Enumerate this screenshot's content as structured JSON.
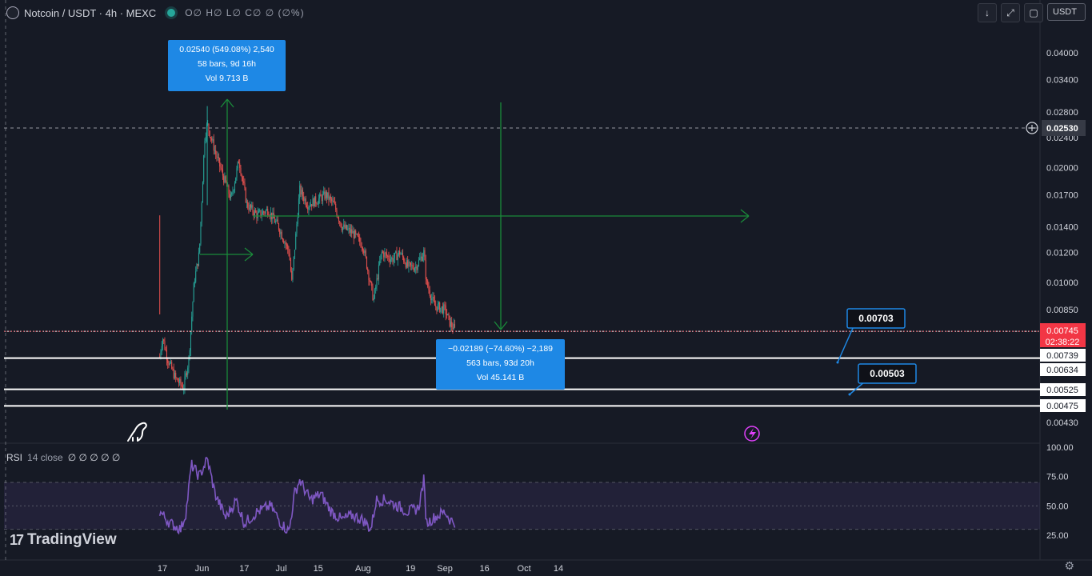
{
  "header": {
    "title": "Notcoin / USDT · 4h · MEXC",
    "ohlc": "O∅ H∅ L∅ C∅ ∅ (∅%)"
  },
  "toolbar": {
    "currency": "USDT"
  },
  "price_axis": {
    "ticks": [
      "0.04000",
      "0.03400",
      "0.02800",
      "0.02400",
      "0.02000",
      "0.01700",
      "0.01400",
      "0.01200",
      "0.01000",
      "0.00850",
      "0.00430"
    ],
    "crosshair_label": "0.02530",
    "current_price": "0.00745",
    "countdown": "02:38:22",
    "level_labels": [
      "0.00739",
      "0.00634",
      "0.00525",
      "0.00475"
    ]
  },
  "rsi_axis": {
    "ticks": [
      "100.00",
      "75.00",
      "50.00",
      "25.00"
    ]
  },
  "time_axis": {
    "labels": [
      "17",
      "Jun",
      "17",
      "Jul",
      "15",
      "Aug",
      "19",
      "Sep",
      "16",
      "Oct",
      "14"
    ]
  },
  "annotations": {
    "measure_up": [
      "0.02540 (549.08%) 2,540",
      "58 bars, 9d 16h",
      "Vol 9.713 B"
    ],
    "measure_down": [
      "−0.02189 (−74.60%) −2,189",
      "563 bars, 93d 20h",
      "Vol 45.141 B"
    ],
    "callout_1": "0.00703",
    "callout_2": "0.00503"
  },
  "rsi_legend": {
    "name": "RSI",
    "params": "14 close",
    "values": "∅ ∅ ∅ ∅ ∅"
  },
  "branding": "TradingView",
  "colors": {
    "background": "#161a25",
    "up": "#26a69a",
    "down": "#ef5350",
    "rsi": "#7e57c2",
    "measure": "#1a8a3a",
    "label_blue": "#1e88e5",
    "price_red": "#f23645"
  },
  "chart_data": {
    "type": "candlestick",
    "price_scale": "log",
    "ylim": [
      0.0041,
      0.046
    ],
    "x_start": "2024-05-16",
    "price_path": [
      {
        "x": "2024-05-16",
        "y": 0.0064
      },
      {
        "x": "2024-05-17",
        "y": 0.0072
      },
      {
        "x": "2024-05-19",
        "y": 0.0063
      },
      {
        "x": "2024-05-22",
        "y": 0.0056
      },
      {
        "x": "2024-05-25",
        "y": 0.0053
      },
      {
        "x": "2024-05-27",
        "y": 0.0063
      },
      {
        "x": "2024-05-29",
        "y": 0.01
      },
      {
        "x": "2024-05-31",
        "y": 0.012
      },
      {
        "x": "2024-06-02",
        "y": 0.024
      },
      {
        "x": "2024-06-03",
        "y": 0.026
      },
      {
        "x": "2024-06-06",
        "y": 0.022
      },
      {
        "x": "2024-06-09",
        "y": 0.019
      },
      {
        "x": "2024-06-12",
        "y": 0.0165
      },
      {
        "x": "2024-06-15",
        "y": 0.021
      },
      {
        "x": "2024-06-18",
        "y": 0.016
      },
      {
        "x": "2024-06-22",
        "y": 0.015
      },
      {
        "x": "2024-06-26",
        "y": 0.0155
      },
      {
        "x": "2024-06-30",
        "y": 0.014
      },
      {
        "x": "2024-07-04",
        "y": 0.012
      },
      {
        "x": "2024-07-05",
        "y": 0.01
      },
      {
        "x": "2024-07-08",
        "y": 0.0175
      },
      {
        "x": "2024-07-11",
        "y": 0.016
      },
      {
        "x": "2024-07-15",
        "y": 0.0165
      },
      {
        "x": "2024-07-18",
        "y": 0.017
      },
      {
        "x": "2024-07-21",
        "y": 0.016
      },
      {
        "x": "2024-07-24",
        "y": 0.014
      },
      {
        "x": "2024-07-28",
        "y": 0.0135
      },
      {
        "x": "2024-08-01",
        "y": 0.0125
      },
      {
        "x": "2024-08-05",
        "y": 0.009
      },
      {
        "x": "2024-08-08",
        "y": 0.012
      },
      {
        "x": "2024-08-12",
        "y": 0.0115
      },
      {
        "x": "2024-08-15",
        "y": 0.012
      },
      {
        "x": "2024-08-18",
        "y": 0.011
      },
      {
        "x": "2024-08-21",
        "y": 0.011
      },
      {
        "x": "2024-08-24",
        "y": 0.012
      },
      {
        "x": "2024-08-25",
        "y": 0.01
      },
      {
        "x": "2024-08-28",
        "y": 0.0087
      },
      {
        "x": "2024-09-01",
        "y": 0.0085
      },
      {
        "x": "2024-09-03",
        "y": 0.0078
      },
      {
        "x": "2024-09-05",
        "y": 0.0075
      }
    ],
    "spike_highs": [
      {
        "x": "2024-05-16",
        "y": 0.015
      },
      {
        "x": "2024-06-03",
        "y": 0.029
      }
    ],
    "support_lines": [
      0.00745,
      0.00634,
      0.00525,
      0.00475
    ],
    "rsi": {
      "ylim": [
        0,
        100
      ],
      "bands": [
        30,
        70
      ],
      "points": [
        {
          "x": "2024-05-16",
          "y": 45
        },
        {
          "x": "2024-05-20",
          "y": 35
        },
        {
          "x": "2024-05-24",
          "y": 30
        },
        {
          "x": "2024-05-26",
          "y": 45
        },
        {
          "x": "2024-05-28",
          "y": 85
        },
        {
          "x": "2024-05-31",
          "y": 75
        },
        {
          "x": "2024-06-03",
          "y": 90
        },
        {
          "x": "2024-06-06",
          "y": 60
        },
        {
          "x": "2024-06-10",
          "y": 40
        },
        {
          "x": "2024-06-14",
          "y": 55
        },
        {
          "x": "2024-06-17",
          "y": 35
        },
        {
          "x": "2024-06-22",
          "y": 45
        },
        {
          "x": "2024-06-27",
          "y": 50
        },
        {
          "x": "2024-07-01",
          "y": 35
        },
        {
          "x": "2024-07-04",
          "y": 28
        },
        {
          "x": "2024-07-06",
          "y": 60
        },
        {
          "x": "2024-07-08",
          "y": 72
        },
        {
          "x": "2024-07-12",
          "y": 55
        },
        {
          "x": "2024-07-16",
          "y": 60
        },
        {
          "x": "2024-07-20",
          "y": 45
        },
        {
          "x": "2024-07-24",
          "y": 38
        },
        {
          "x": "2024-07-28",
          "y": 42
        },
        {
          "x": "2024-08-01",
          "y": 38
        },
        {
          "x": "2024-08-04",
          "y": 30
        },
        {
          "x": "2024-08-06",
          "y": 55
        },
        {
          "x": "2024-08-10",
          "y": 55
        },
        {
          "x": "2024-08-14",
          "y": 50
        },
        {
          "x": "2024-08-18",
          "y": 45
        },
        {
          "x": "2024-08-22",
          "y": 48
        },
        {
          "x": "2024-08-24",
          "y": 72
        },
        {
          "x": "2024-08-25",
          "y": 35
        },
        {
          "x": "2024-08-28",
          "y": 40
        },
        {
          "x": "2024-09-01",
          "y": 45
        },
        {
          "x": "2024-09-03",
          "y": 38
        },
        {
          "x": "2024-09-05",
          "y": 36
        }
      ]
    }
  }
}
